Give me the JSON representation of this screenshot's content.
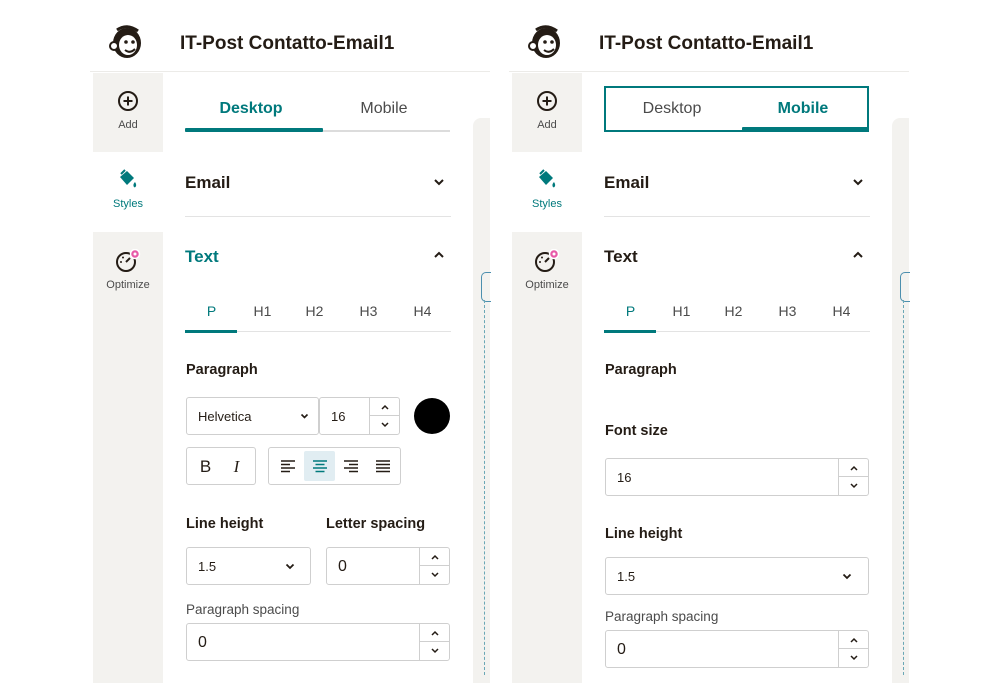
{
  "app": {
    "title": "IT-Post Contatto-Email1",
    "logo": "mailchimp-freddie-logo"
  },
  "colors": {
    "accent": "#00797c",
    "rail_bg": "#f3f2ef",
    "notification_dot": "#e85aa8"
  },
  "rail": {
    "add_label": "Add",
    "styles_label": "Styles",
    "optimize_label": "Optimize",
    "add_icon": "plus-circle-icon",
    "styles_icon": "paint-bucket-icon",
    "optimize_icon": "gauge-icon"
  },
  "tabs": {
    "desktop_label": "Desktop",
    "mobile_label": "Mobile"
  },
  "sections": {
    "email_label": "Email",
    "text_label": "Text"
  },
  "heading_tabs": [
    "P",
    "H1",
    "H2",
    "H3",
    "H4"
  ],
  "desktop_panel": {
    "active_tab": "Desktop",
    "paragraph_label": "Paragraph",
    "font_family": "Helvetica",
    "font_size": "16",
    "text_color": "#000000",
    "bold_label": "B",
    "italic_label": "I",
    "alignment_options": [
      "left",
      "center",
      "right",
      "justify"
    ],
    "active_alignment": "center",
    "line_height_label": "Line height",
    "line_height_value": "1.5",
    "letter_spacing_label": "Letter spacing",
    "letter_spacing_value": "0",
    "paragraph_spacing_label": "Paragraph spacing",
    "paragraph_spacing_value": "0"
  },
  "mobile_panel": {
    "active_tab": "Mobile",
    "paragraph_label": "Paragraph",
    "font_size_label": "Font size",
    "font_size_value": "16",
    "line_height_label": "Line height",
    "line_height_value": "1.5",
    "paragraph_spacing_label": "Paragraph spacing",
    "paragraph_spacing_value": "0"
  }
}
